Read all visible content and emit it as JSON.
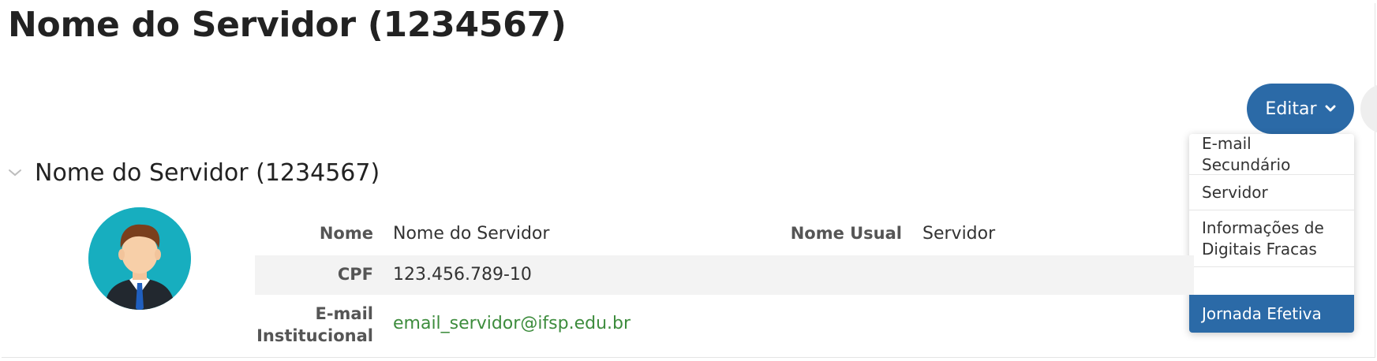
{
  "page": {
    "title": "Nome do Servidor (1234567)"
  },
  "actions": {
    "edit_label": "Editar",
    "edit_icon": "chevron-down-icon",
    "menu": [
      {
        "label": "E-mail Secundário",
        "lines": [
          "E-mail",
          "Secundário"
        ]
      },
      {
        "label": "Servidor",
        "lines": [
          "Servidor"
        ]
      },
      {
        "label": "Informações de Digitais Fracas",
        "lines": [
          "Informações de",
          "Digitais Fracas"
        ]
      },
      {
        "label": "Jornada Efetiva",
        "lines": [
          "Jornada Efetiva"
        ],
        "active": true
      }
    ]
  },
  "section": {
    "title": "Nome do Servidor (1234567)",
    "collapse_icon": "chevron-down-icon"
  },
  "profile": {
    "avatar_icon": "person-avatar-icon",
    "fields": {
      "nome": {
        "label": "Nome",
        "value": "Nome do Servidor"
      },
      "nome_usual": {
        "label": "Nome Usual",
        "value": "Servidor"
      },
      "cpf": {
        "label": "CPF",
        "value": "123.456.789-10"
      },
      "email": {
        "label_line1": "E-mail",
        "label_line2": "Institucional",
        "value": "email_servidor@ifsp.edu.br"
      }
    }
  },
  "colors": {
    "primary": "#2b6aa7",
    "avatar_bg": "#17aebf",
    "link": "#3d8c3d"
  }
}
